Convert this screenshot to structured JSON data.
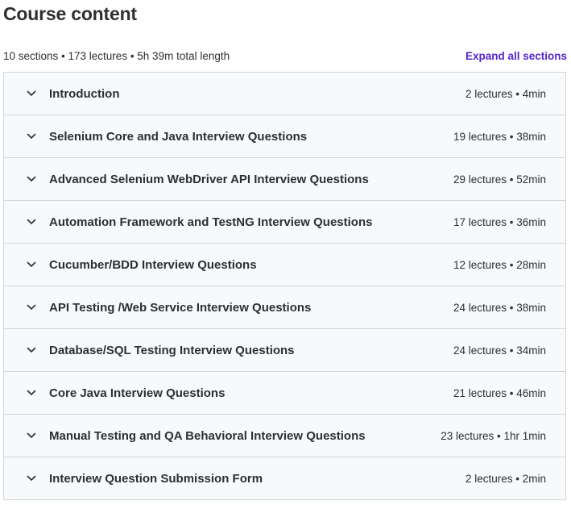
{
  "header": {
    "title": "Course content",
    "summary": "10 sections • 173 lectures • 5h 39m total length",
    "expand_all_label": "Expand all sections"
  },
  "colors": {
    "link": "#5624d0",
    "section_bg": "#f7f9fa",
    "border": "#d1d7dc",
    "text": "#2d2f31"
  },
  "sections": [
    {
      "title": "Introduction",
      "meta": "2 lectures • 4min",
      "icon": "chevron-down-icon"
    },
    {
      "title": "Selenium Core and Java Interview Questions",
      "meta": "19 lectures • 38min",
      "icon": "chevron-down-icon"
    },
    {
      "title": "Advanced Selenium WebDriver API Interview Questions",
      "meta": "29 lectures • 52min",
      "icon": "chevron-down-icon"
    },
    {
      "title": "Automation Framework and TestNG Interview Questions",
      "meta": "17 lectures • 36min",
      "icon": "chevron-down-icon"
    },
    {
      "title": "Cucumber/BDD Interview Questions",
      "meta": "12 lectures • 28min",
      "icon": "chevron-down-icon"
    },
    {
      "title": "API Testing /Web Service Interview Questions",
      "meta": "24 lectures • 38min",
      "icon": "chevron-down-icon"
    },
    {
      "title": "Database/SQL Testing Interview Questions",
      "meta": "24 lectures • 34min",
      "icon": "chevron-down-icon"
    },
    {
      "title": "Core Java Interview Questions",
      "meta": "21 lectures • 46min",
      "icon": "chevron-down-icon"
    },
    {
      "title": "Manual Testing and QA Behavioral Interview Questions",
      "meta": "23 lectures • 1hr 1min",
      "icon": "chevron-down-icon"
    },
    {
      "title": "Interview Question Submission Form",
      "meta": "2 lectures • 2min",
      "icon": "chevron-down-icon"
    }
  ]
}
